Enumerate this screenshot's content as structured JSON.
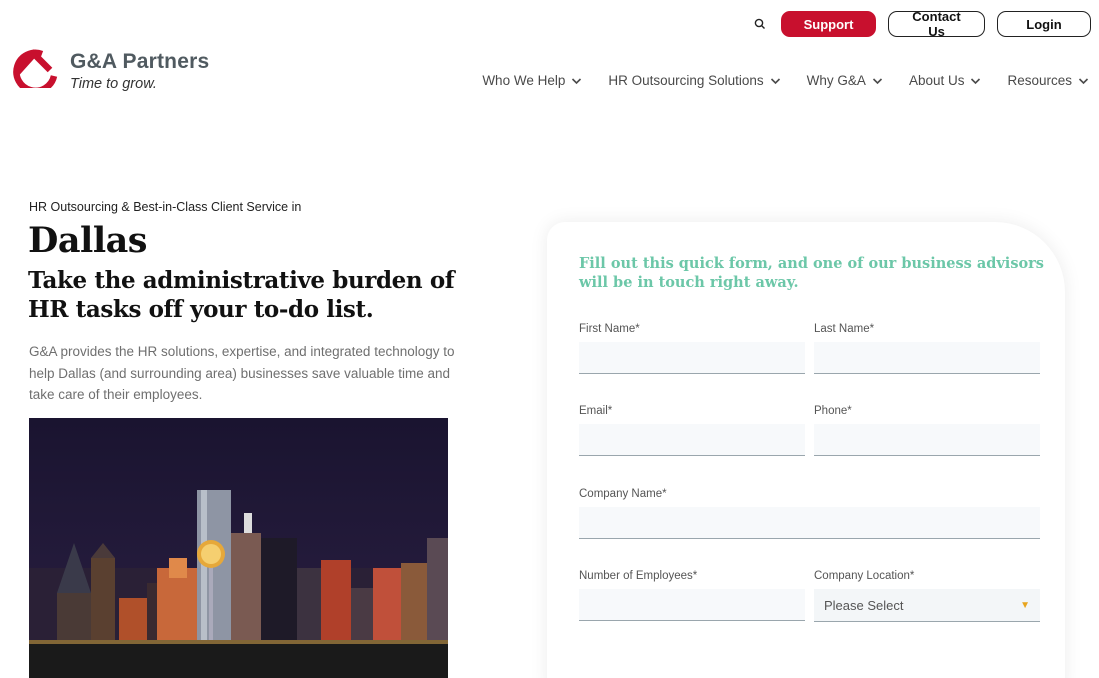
{
  "header": {
    "support_label": "Support",
    "contact_label": "Contact Us",
    "login_label": "Login",
    "logo_name": "G&A Partners",
    "logo_tagline": "Time to grow.",
    "nav": [
      "Who We Help",
      "HR Outsourcing Solutions",
      "Why G&A",
      "About Us",
      "Resources"
    ]
  },
  "hero": {
    "eyebrow": "HR Outsourcing & Best-in-Class Client Service in",
    "city": "Dallas",
    "headline": "Take the administrative burden of HR tasks off your to-do list.",
    "intro": "G&A provides the HR solutions, expertise, and integrated technology to help Dallas (and surrounding area) businesses save valuable time and take care of their employees."
  },
  "form": {
    "intro": "Fill out this quick form, and one of our business advisors will be in touch right away.",
    "first_name_label": "First Name*",
    "last_name_label": "Last Name*",
    "email_label": "Email*",
    "phone_label": "Phone*",
    "company_label": "Company Name*",
    "employees_label": "Number of Employees*",
    "location_label": "Company Location*",
    "location_value": "Please Select"
  },
  "colors": {
    "brand_red": "#c8102e",
    "form_accent": "#6cc7a8"
  }
}
